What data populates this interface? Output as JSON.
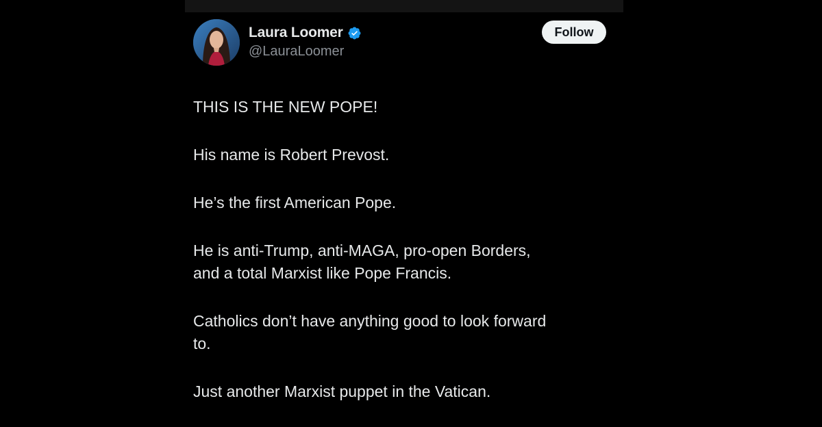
{
  "tweet": {
    "author": {
      "display_name": "Laura Loomer",
      "handle": "@LauraLoomer",
      "verified": true,
      "verified_icon": "verified-badge-icon",
      "verified_color": "#1d9bf0"
    },
    "follow_label": "Follow",
    "paragraphs": [
      "THIS IS THE NEW POPE!",
      "His name is Robert Prevost.",
      "He’s the first American Pope.",
      "He is anti-Trump, anti-MAGA, pro-open Borders,\nand a total Marxist like Pope Francis.",
      "Catholics don’t have anything good to look forward\nto.",
      "Just another Marxist puppet in the Vatican."
    ]
  },
  "colors": {
    "background": "#000000",
    "text_primary": "#e7e9ea",
    "text_secondary": "#8b9096",
    "follow_button_bg": "#eff3f4",
    "follow_button_text": "#0f1419"
  }
}
